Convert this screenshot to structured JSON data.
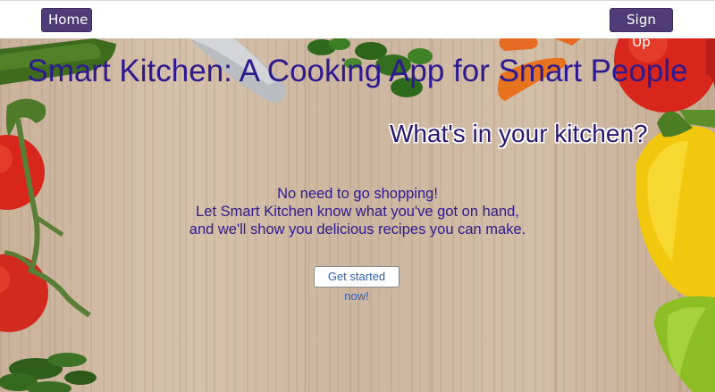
{
  "nav": {
    "home_label": "Home",
    "signup_label": "Sign Up"
  },
  "hero": {
    "title": "Smart Kitchen: A Cooking App for Smart People",
    "subtitle": "What's in your kitchen?",
    "tagline_lines": [
      "No need to go shopping!",
      "Let Smart Kitchen know what you've got on hand,",
      "and we'll show you delicious recipes you can make."
    ],
    "cta_label": "Get started now!"
  },
  "colors": {
    "nav_button": "#4e3b78",
    "title_text": "#2d1a8f",
    "cta_text": "#2f5fb0"
  }
}
